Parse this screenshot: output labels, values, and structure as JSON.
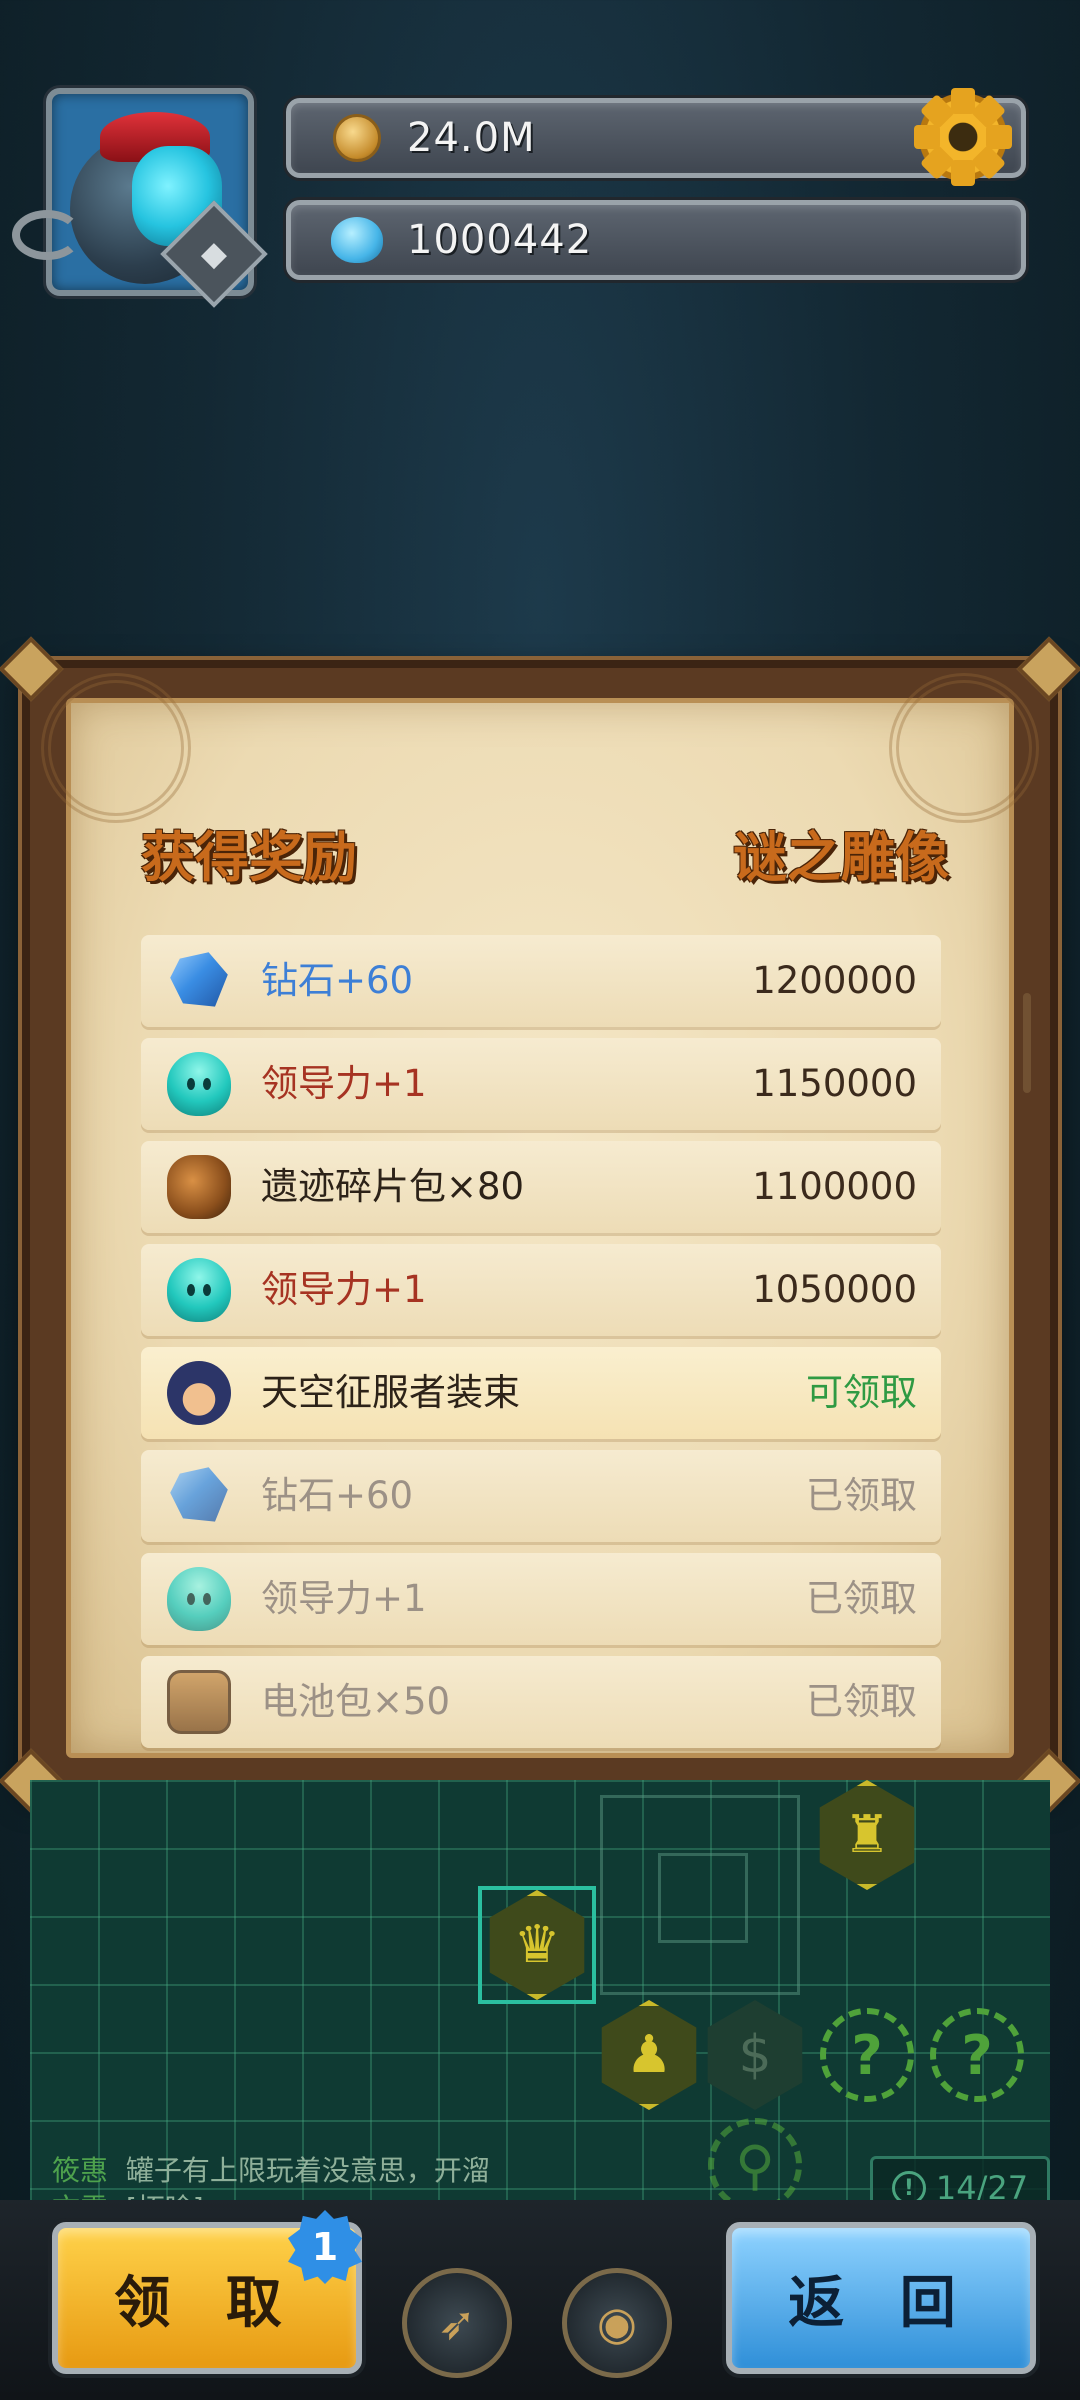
{
  "hud": {
    "gold": "24.0M",
    "gems": "1000442"
  },
  "dialog": {
    "title_left": "获得奖励",
    "title_right": "谜之雕像",
    "rewards": [
      {
        "name": "钻石+60",
        "value": "1200000",
        "icon": "diamond-icon",
        "name_color": "#3d7fd6",
        "status": "available"
      },
      {
        "name": "领导力+1",
        "value": "1150000",
        "icon": "leadership-slime-icon",
        "name_color": "#a63322",
        "status": "available"
      },
      {
        "name": "遗迹碎片包×80",
        "value": "1100000",
        "icon": "relic-fragment-pack-icon",
        "name_color": "#2c2218",
        "status": "available"
      },
      {
        "name": "领导力+1",
        "value": "1050000",
        "icon": "leadership-slime-icon",
        "name_color": "#a63322",
        "status": "available"
      },
      {
        "name": "天空征服者装束",
        "value": "可领取",
        "icon": "sky-conqueror-outfit-icon",
        "name_color": "#2c2218",
        "value_color": "#2f9a43",
        "status": "claimable"
      },
      {
        "name": "钻石+60",
        "value": "已领取",
        "icon": "diamond-icon",
        "status": "claimed"
      },
      {
        "name": "领导力+1",
        "value": "已领取",
        "icon": "leadership-slime-icon",
        "status": "claimed"
      },
      {
        "name": "电池包×50",
        "value": "已领取",
        "icon": "battery-pack-icon",
        "status": "claimed"
      }
    ]
  },
  "chat": {
    "line1_name": "筱惠",
    "line1_msg": "罐子有上限玩着没意思，开溜",
    "line2_name": "文雪",
    "line2_msg": "[拓晗]"
  },
  "progress": "14/27",
  "buttons": {
    "claim": "领 取",
    "claim_badge": "1",
    "back": "返 回"
  },
  "colors": {
    "title_orange": "#c86a1c",
    "claimable_green": "#2f9a43",
    "claimed_gray": "#9c9186",
    "claim_button": "#f5b52a",
    "back_button": "#4aa6ec"
  }
}
